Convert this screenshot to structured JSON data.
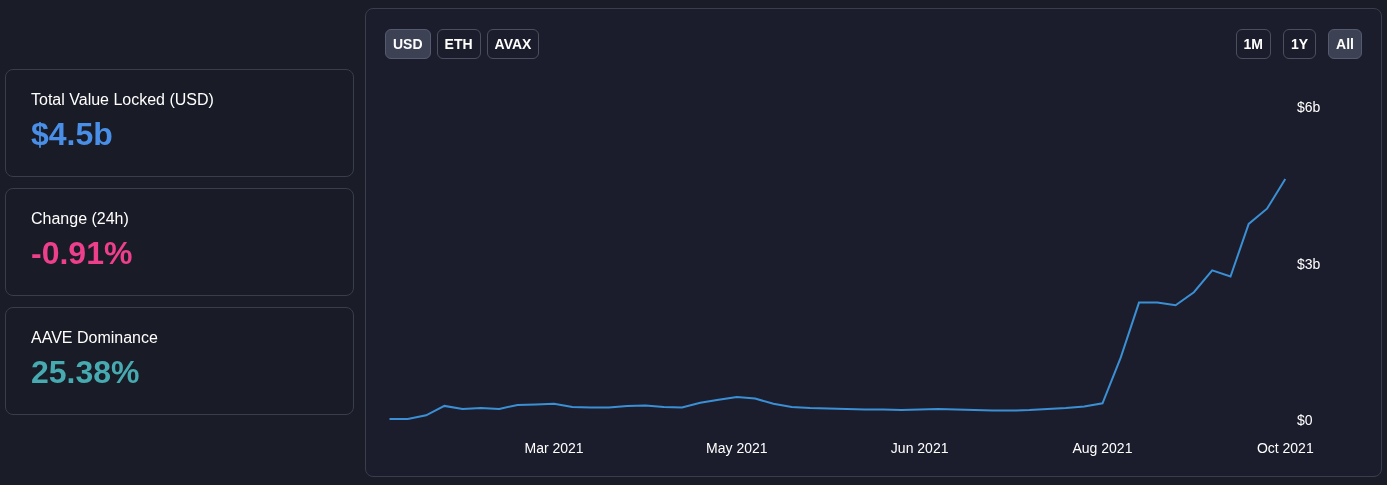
{
  "stats": [
    {
      "label": "Total Value Locked (USD)",
      "value": "$4.5b",
      "color": "#4a8fe7"
    },
    {
      "label": "Change (24h)",
      "value": "-0.91%",
      "color": "#ed3f8c"
    },
    {
      "label": "AAVE Dominance",
      "value": "25.38%",
      "color": "#46aab0"
    }
  ],
  "currencies": [
    {
      "label": "USD",
      "selected": true
    },
    {
      "label": "ETH",
      "selected": false
    },
    {
      "label": "AVAX",
      "selected": false
    }
  ],
  "ranges": [
    {
      "label": "1M",
      "selected": false
    },
    {
      "label": "1Y",
      "selected": false
    },
    {
      "label": "All",
      "selected": true
    }
  ],
  "chart": {
    "chart_data": {
      "type": "line",
      "categories": [
        null,
        null,
        null,
        null,
        null,
        null,
        null,
        null,
        null,
        "Mar 2021",
        null,
        null,
        null,
        null,
        null,
        null,
        null,
        null,
        null,
        "May 2021",
        null,
        null,
        null,
        null,
        null,
        null,
        null,
        null,
        null,
        "Jun 2021",
        null,
        null,
        null,
        null,
        null,
        null,
        null,
        null,
        null,
        "Aug 2021",
        null,
        null,
        null,
        null,
        null,
        null,
        null,
        null,
        null,
        "Oct 2021"
      ],
      "series": [
        {
          "color": "#3b8fd4",
          "values": [
            0.02,
            0.02,
            0.09,
            0.27,
            0.21,
            0.23,
            0.21,
            0.29,
            0.3,
            0.31,
            0.25,
            0.24,
            0.24,
            0.27,
            0.28,
            0.25,
            0.24,
            0.33,
            0.39,
            0.44,
            0.41,
            0.31,
            0.25,
            0.23,
            0.22,
            0.21,
            0.2,
            0.2,
            0.19,
            0.2,
            0.21,
            0.2,
            0.19,
            0.18,
            0.18,
            0.19,
            0.21,
            0.23,
            0.26,
            0.32,
            1.2,
            2.25,
            2.25,
            2.2,
            2.45,
            2.87,
            2.75,
            3.76,
            4.05,
            4.62
          ]
        }
      ],
      "ylim": [
        0,
        6
      ],
      "yticks": [
        {
          "value": 0,
          "label": "$0"
        },
        {
          "value": 3,
          "label": "$3b"
        },
        {
          "value": 6,
          "label": "$6b"
        }
      ]
    }
  }
}
